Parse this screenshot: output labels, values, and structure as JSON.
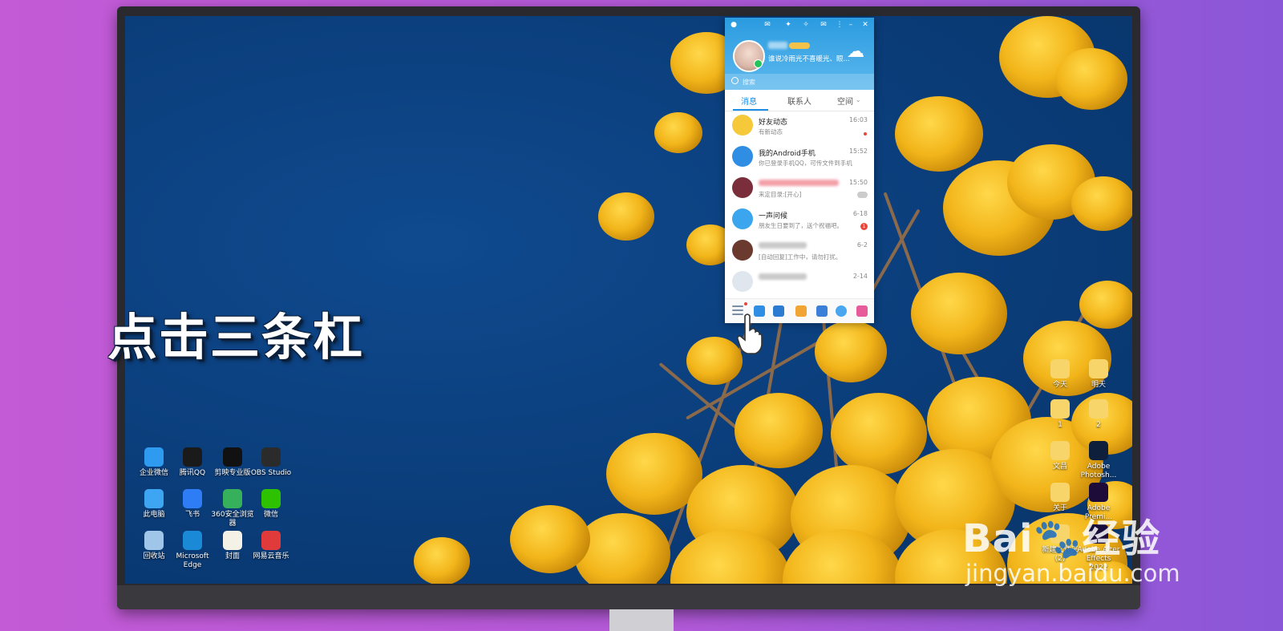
{
  "caption": "点击三条杠",
  "watermark": {
    "brand": "Bai",
    "brand_cn": "经验",
    "url": "jingyan.baidu.com"
  },
  "desktop_left": [
    {
      "label": "企业微信",
      "color": "#2e9bf0"
    },
    {
      "label": "腾讯QQ",
      "color": "#1a1a1a"
    },
    {
      "label": "剪映专业版",
      "color": "#111111"
    },
    {
      "label": "OBS Studio",
      "color": "#2b2b2b"
    },
    {
      "label": "此电脑",
      "color": "#3ea5f2"
    },
    {
      "label": "飞书",
      "color": "#2f7df6"
    },
    {
      "label": "360安全浏览器",
      "color": "#36b05a"
    },
    {
      "label": "微信",
      "color": "#2dc100"
    },
    {
      "label": "回收站",
      "color": "#9fc5e8"
    },
    {
      "label": "Microsoft Edge",
      "color": "#1b8ad6"
    },
    {
      "label": "封面",
      "color": "#f4f1e6"
    },
    {
      "label": "网易云音乐",
      "color": "#e03a3a"
    }
  ],
  "desktop_right": [
    {
      "label": "今天",
      "color": "#f7d56b"
    },
    {
      "label": "明天",
      "color": "#f7d56b"
    },
    {
      "label": "1",
      "color": "#f7d56b"
    },
    {
      "label": "2",
      "color": "#f7d56b"
    },
    {
      "label": "文昌",
      "color": "#f7d56b"
    },
    {
      "label": "Adobe Photosh...",
      "color": "#0d1f3a"
    },
    {
      "label": "关于",
      "color": "#f7d56b"
    },
    {
      "label": "Adobe Premi...",
      "color": "#1d0b3a"
    },
    {
      "label": "新建文件夹 (2)",
      "color": "#f7d56b"
    },
    {
      "label": "Adobe After Effects 2022",
      "color": "#1a0d3a"
    }
  ],
  "qq": {
    "signature": "谁说冷雨光不喜暖光、眼...",
    "search_placeholder": "搜索",
    "tabs": [
      "消息",
      "联系人",
      "空间"
    ],
    "chats": [
      {
        "name": "好友动态",
        "preview": "有新动态",
        "time": "16:03",
        "indicator": "dot",
        "avatar": "#f5c93a"
      },
      {
        "name": "我的Android手机",
        "preview": "你已登录手机QQ，可传文件到手机",
        "time": "15:52",
        "indicator": "none",
        "avatar": "#2f8de4"
      },
      {
        "name": "",
        "preview": "来定目录:[开心]",
        "time": "15:50",
        "indicator": "mute",
        "avatar": "#7a2e3c"
      },
      {
        "name": "一声问候",
        "preview": "朋友生日要到了，送个祝福吧。",
        "time": "6-18",
        "indicator": "badge",
        "badge": "1",
        "avatar": "#3ba6ee"
      },
      {
        "name": "",
        "preview": "[自动回复]工作中，请勿打扰。",
        "time": "6-2",
        "indicator": "none",
        "avatar": "#6b3a2e"
      },
      {
        "name": "",
        "preview": "",
        "time": "2-14",
        "indicator": "none",
        "avatar": "#dfe6ee"
      }
    ]
  }
}
